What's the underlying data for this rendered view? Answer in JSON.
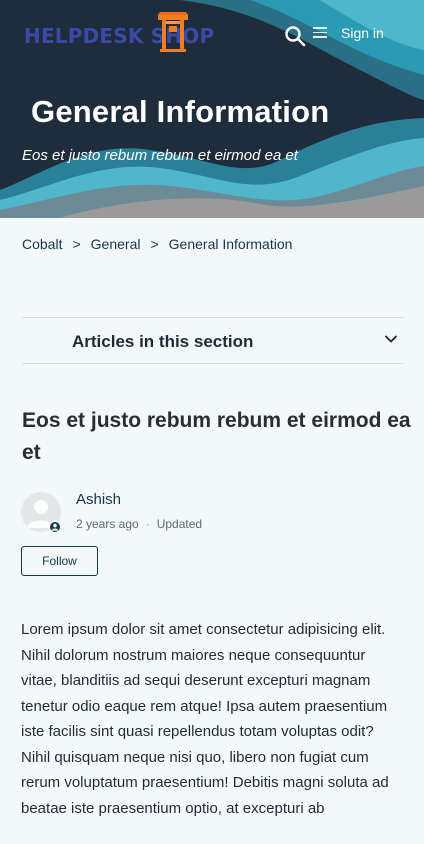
{
  "header": {
    "logo_text": "HELPDESK SHOP",
    "signin_label": "Sign in",
    "search_icon": "search-icon",
    "menu_icon": "menu-icon"
  },
  "hero": {
    "title": "General Information",
    "subtitle": "Eos et justo rebum rebum et eirmod ea et"
  },
  "breadcrumb": {
    "items": [
      "Cobalt",
      "General",
      "General Information"
    ],
    "separator": ">"
  },
  "section": {
    "label": "Articles in this section",
    "toggle_icon": "chevron-down-icon"
  },
  "article": {
    "title": "Eos et justo rebum rebum et eirmod ea et",
    "author": "Ashish",
    "posted": "2 years ago",
    "meta_separator": "·",
    "updated": "Updated",
    "follow_label": "Follow",
    "body": "Lorem ipsum dolor sit amet consectetur adipisicing elit. Nihil dolorum nostrum maiores neque consequuntur vitae, blanditiis ad sequi deserunt excepturi magnam tenetur odio eaque rem atque! Ipsa autem praesentium iste facilis sint quasi repellendus totam voluptas odit? Nihil quisquam neque nisi quo, libero non fugiat cum rerum voluptatum praesentium! Debitis magni soluta ad beatae iste praesentium optio, at excepturi ab"
  },
  "colors": {
    "page_background": "#f3f8fb",
    "hero_dark": "#1f2c3b",
    "wave_teal": "#2a9bb3",
    "logo_text": "#3a4aa8",
    "logo_accent": "#f07c24",
    "link": "#17364a"
  }
}
